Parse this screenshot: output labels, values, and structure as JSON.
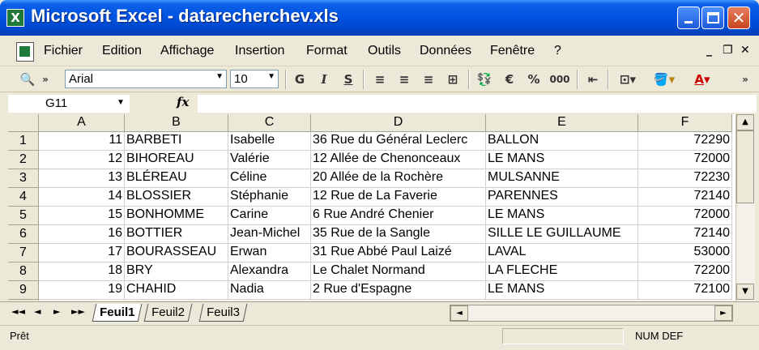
{
  "window": {
    "title": "Microsoft Excel - datarecherchev.xls",
    "close_glyph": "✕"
  },
  "menu": {
    "items": [
      "Fichier",
      "Edition",
      "Affichage",
      "Insertion",
      "Format",
      "Outils",
      "Données",
      "Fenêtre",
      "?"
    ]
  },
  "toolbar": {
    "font_name": "Arial",
    "font_size": "10",
    "bold": "G",
    "italic": "I",
    "underline": "S",
    "euro": "€",
    "percent": "%",
    "thousands": "000",
    "font_color_letter": "A",
    "icons": [
      "research-icon",
      "align-left-icon",
      "center-icon",
      "align-right-icon",
      "merge-center-icon",
      "currency-icon",
      "euro-icon",
      "percent-icon",
      "thousands-icon",
      "decrease-indent-icon",
      "borders-icon",
      "fill-color-icon",
      "font-color-icon"
    ]
  },
  "formula": {
    "cell_ref": "G11",
    "fx_label": "fx",
    "value": ""
  },
  "grid": {
    "columns": [
      "A",
      "B",
      "C",
      "D",
      "E",
      "F"
    ],
    "rows": [
      {
        "n": "1",
        "cells": [
          "11",
          "BARBETI",
          "Isabelle",
          "36 Rue du Général Leclerc",
          "BALLON",
          "72290"
        ]
      },
      {
        "n": "2",
        "cells": [
          "12",
          "BIHOREAU",
          "Valérie",
          "12 Allée de Chenonceaux",
          "LE MANS",
          "72000"
        ]
      },
      {
        "n": "3",
        "cells": [
          "13",
          "BLÉREAU",
          "Céline",
          "20 Allée de la Rochère",
          "MULSANNE",
          "72230"
        ]
      },
      {
        "n": "4",
        "cells": [
          "14",
          "BLOSSIER",
          "Stéphanie",
          "12 Rue de La Faverie",
          "PARENNES",
          "72140"
        ]
      },
      {
        "n": "5",
        "cells": [
          "15",
          "BONHOMME",
          "Carine",
          "6 Rue André Chenier",
          "LE MANS",
          "72000"
        ]
      },
      {
        "n": "6",
        "cells": [
          "16",
          "BOTTIER",
          "Jean-Michel",
          "35 Rue de la Sangle",
          "SILLE LE GUILLAUME",
          "72140"
        ]
      },
      {
        "n": "7",
        "cells": [
          "17",
          "BOURASSEAU",
          "Erwan",
          "31 Rue Abbé Paul Laizé",
          "LAVAL",
          "53000"
        ]
      },
      {
        "n": "8",
        "cells": [
          "18",
          "BRY",
          "Alexandra",
          "Le Chalet Normand",
          "LA FLECHE",
          "72200"
        ]
      },
      {
        "n": "9",
        "cells": [
          "19",
          "CHAHID",
          "Nadia",
          "2 Rue d'Espagne",
          "LE MANS",
          "72100"
        ]
      }
    ]
  },
  "sheets": {
    "tabs": [
      "Feuil1",
      "Feuil2",
      "Feuil3"
    ],
    "active": "Feuil1",
    "nav": [
      "◄◄",
      "◄",
      "►",
      "►►"
    ]
  },
  "status": {
    "text": "Prêt",
    "indicators": "NUM DEF"
  },
  "colors": {
    "title_blue": "#0054e3",
    "chrome": "#ece9d8",
    "close_red": "#c8431e"
  }
}
